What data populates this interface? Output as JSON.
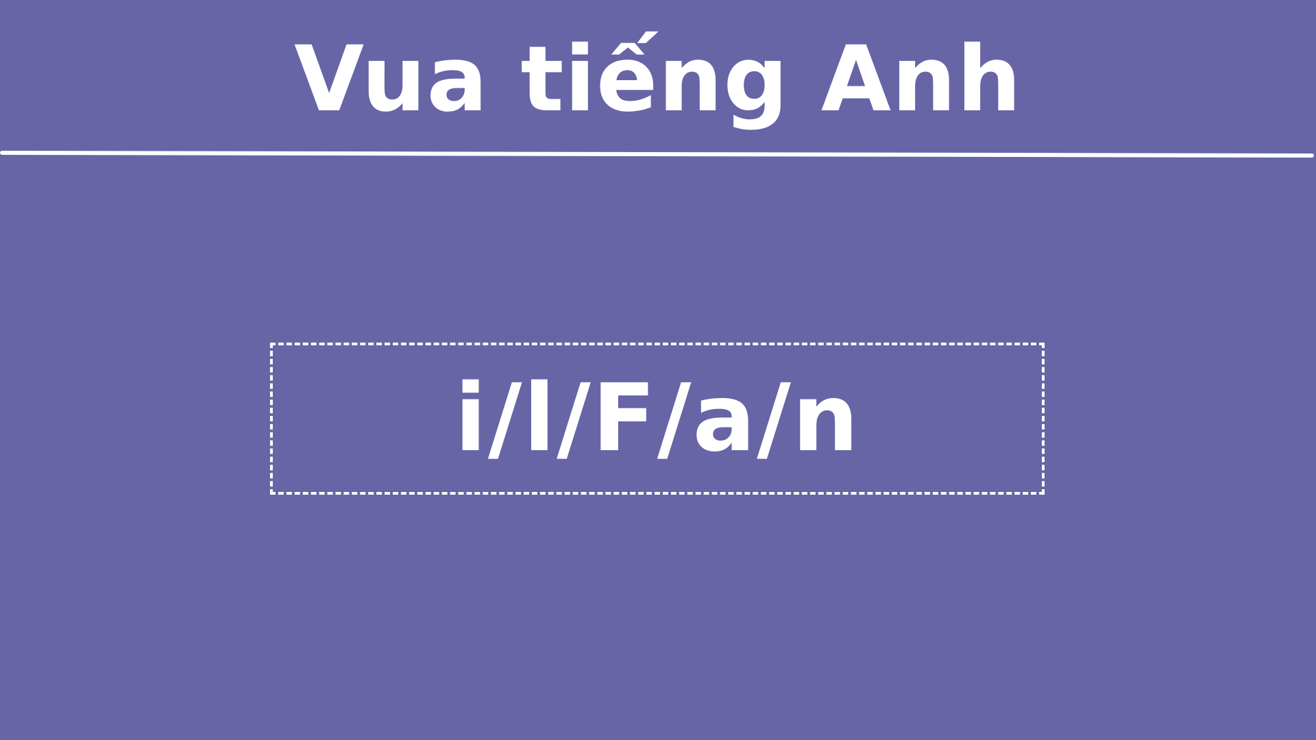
{
  "header": {
    "title": "Vua tiếng Anh"
  },
  "puzzle": {
    "scrambled_letters": "i/l/F/a/n"
  },
  "colors": {
    "background": "#6765a6",
    "foreground": "#ffffff"
  }
}
